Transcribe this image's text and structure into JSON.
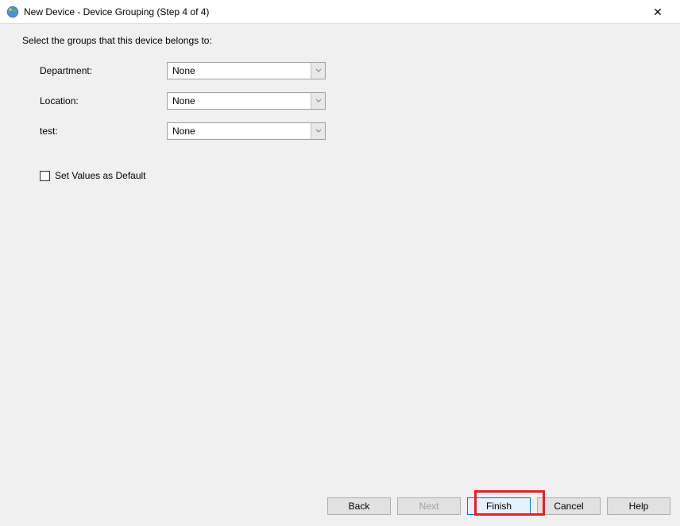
{
  "window": {
    "title": "New Device - Device Grouping (Step 4 of 4)"
  },
  "instruction": "Select the groups that this device belongs to:",
  "fields": [
    {
      "label": "Department:",
      "value": "None"
    },
    {
      "label": "Location:",
      "value": "None"
    },
    {
      "label": "test:",
      "value": "None"
    }
  ],
  "checkbox": {
    "label": "Set Values as Default",
    "checked": false
  },
  "buttons": {
    "back": "Back",
    "next": "Next",
    "finish": "Finish",
    "cancel": "Cancel",
    "help": "Help"
  }
}
